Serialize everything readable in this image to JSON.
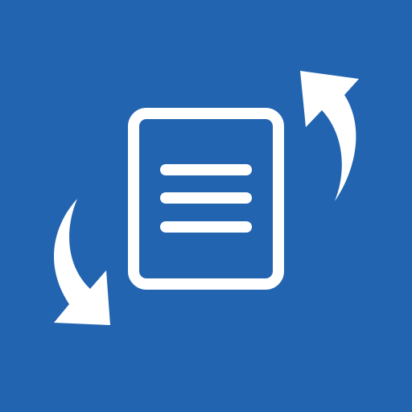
{
  "icon": {
    "name": "document-sync-icon",
    "background_color": "#2364b1",
    "foreground_color": "#ffffff",
    "parts": [
      "document-icon",
      "arrow-up-icon",
      "arrow-down-icon"
    ]
  }
}
